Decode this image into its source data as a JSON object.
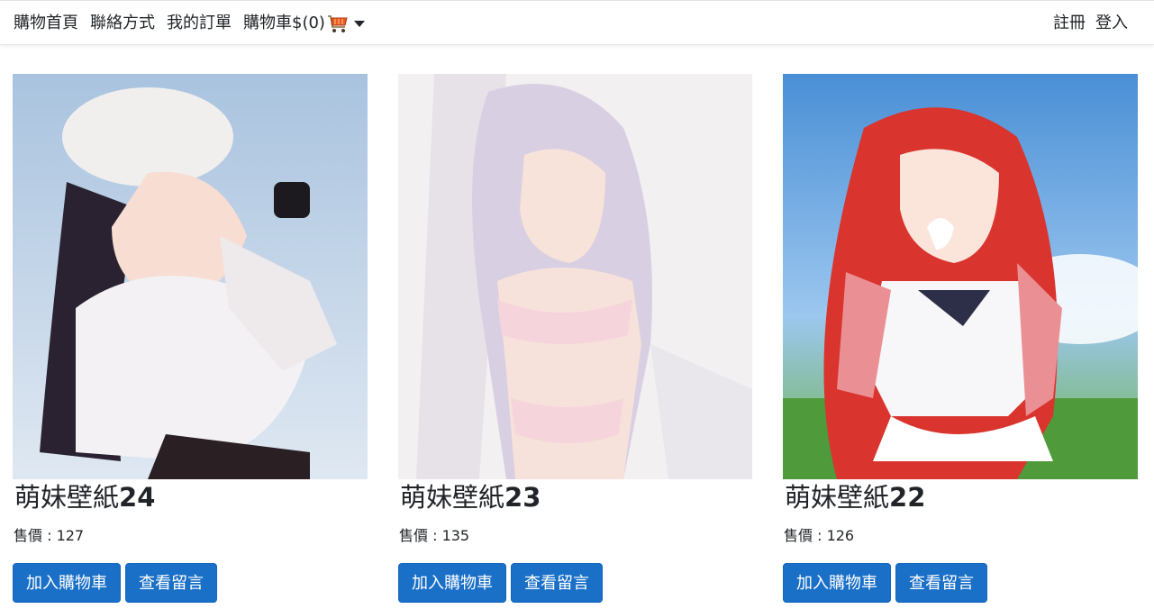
{
  "nav": {
    "home": "購物首頁",
    "contact": "聯絡方式",
    "orders": "我的訂單",
    "cart": "購物車$(0)",
    "register": "註冊",
    "login": "登入"
  },
  "products": [
    {
      "title": "萌妹壁紙",
      "number": "24",
      "price_label": "售價 : 127",
      "add_cart": "加入購物車",
      "view_comments": "查看留言"
    },
    {
      "title": "萌妹壁紙",
      "number": "23",
      "price_label": "售價 : 135",
      "add_cart": "加入購物車",
      "view_comments": "查看留言"
    },
    {
      "title": "萌妹壁紙",
      "number": "22",
      "price_label": "售價 : 126",
      "add_cart": "加入購物車",
      "view_comments": "查看留言"
    }
  ],
  "colors": {
    "button": "#1a6fc7",
    "cart_icon": "#e8582a"
  },
  "icons": {
    "cart": "shopping-cart-icon",
    "dropdown": "caret-down-icon"
  }
}
